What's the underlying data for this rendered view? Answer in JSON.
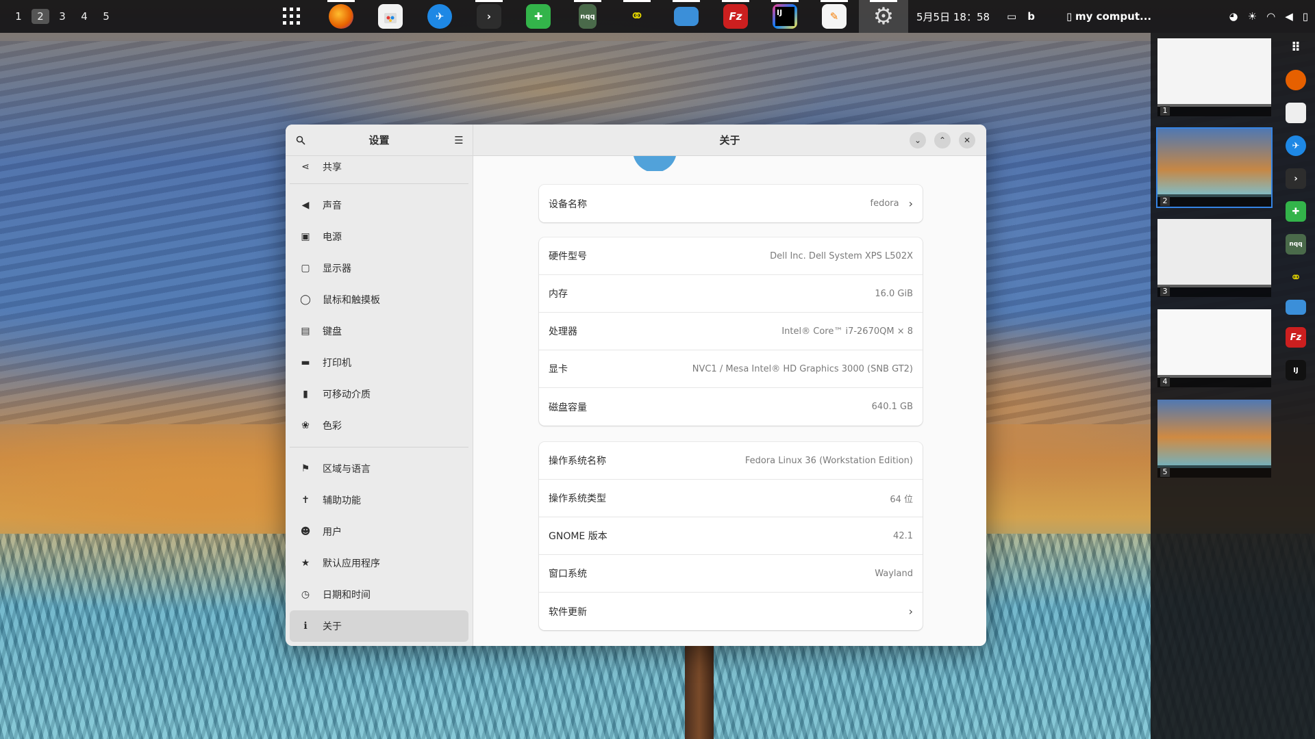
{
  "topbar": {
    "workspaces": [
      "1",
      "2",
      "3",
      "4",
      "5"
    ],
    "active_workspace": "2",
    "clock": "5月5日 18：58",
    "window_title": "my comput...",
    "apps": [
      {
        "name": "app-grid",
        "glyph": "⠿",
        "color": "transparent"
      },
      {
        "name": "firefox",
        "glyph": "ff",
        "color": "#e66000"
      },
      {
        "name": "software-store",
        "glyph": "▦",
        "color": "#e8e8e8"
      },
      {
        "name": "browser",
        "glyph": "✈",
        "color": "#1e88e5"
      },
      {
        "name": "terminal",
        "glyph": ">",
        "color": "#2d2d2d"
      },
      {
        "name": "extensions",
        "glyph": "✚",
        "color": "#33b44a"
      },
      {
        "name": "nqq",
        "glyph": "nqq",
        "color": "#4a6a4a"
      },
      {
        "name": "graph-app",
        "glyph": "⚭",
        "color": "#d4c400"
      },
      {
        "name": "files",
        "glyph": "▭",
        "color": "#3b8fd9"
      },
      {
        "name": "filezilla",
        "glyph": "Fz",
        "color": "#cc1f1f"
      },
      {
        "name": "intellij",
        "glyph": "IJ",
        "color": "#111"
      },
      {
        "name": "text-editor",
        "glyph": "✎",
        "color": "#f0f0f0"
      },
      {
        "name": "settings",
        "glyph": "⚙",
        "color": "#8a8a8a"
      }
    ]
  },
  "sidebar": {
    "title": "设置",
    "items": [
      {
        "label": "共享",
        "icon": "share-icon",
        "glyph": "<"
      },
      {
        "label": "声音",
        "icon": "speaker-icon",
        "glyph": "◀"
      },
      {
        "label": "电源",
        "icon": "power-icon",
        "glyph": "▣"
      },
      {
        "label": "显示器",
        "icon": "display-icon",
        "glyph": "▢"
      },
      {
        "label": "鼠标和触摸板",
        "icon": "mouse-icon",
        "glyph": "◯"
      },
      {
        "label": "键盘",
        "icon": "keyboard-icon",
        "glyph": "▤"
      },
      {
        "label": "打印机",
        "icon": "printer-icon",
        "glyph": "▬"
      },
      {
        "label": "可移动介质",
        "icon": "usb-icon",
        "glyph": "▮"
      },
      {
        "label": "色彩",
        "icon": "color-icon",
        "glyph": "❀"
      },
      {
        "label": "区域与语言",
        "icon": "flag-icon",
        "glyph": "⚑"
      },
      {
        "label": "辅助功能",
        "icon": "accessibility-icon",
        "glyph": "✝"
      },
      {
        "label": "用户",
        "icon": "users-icon",
        "glyph": "☻"
      },
      {
        "label": "默认应用程序",
        "icon": "star-icon",
        "glyph": "★"
      },
      {
        "label": "日期和时间",
        "icon": "clock-icon",
        "glyph": "◷"
      },
      {
        "label": "关于",
        "icon": "info-icon",
        "glyph": "ℹ"
      }
    ]
  },
  "main": {
    "title": "关于",
    "device": {
      "label": "设备名称",
      "value": "fedora"
    },
    "hardware": [
      {
        "label": "硬件型号",
        "value": "Dell Inc. Dell System XPS L502X"
      },
      {
        "label": "内存",
        "value": "16.0 GiB"
      },
      {
        "label": "处理器",
        "value": "Intel® Core™ i7-2670QM × 8"
      },
      {
        "label": "显卡",
        "value": "NVC1 / Mesa Intel® HD Graphics 3000 (SNB GT2)"
      },
      {
        "label": "磁盘容量",
        "value": "640.1 GB"
      }
    ],
    "os": [
      {
        "label": "操作系统名称",
        "value": "Fedora Linux 36 (Workstation Edition)"
      },
      {
        "label": "操作系统类型",
        "value": "64 位"
      },
      {
        "label": "GNOME 版本",
        "value": "42.1"
      },
      {
        "label": "窗口系统",
        "value": "Wayland"
      }
    ],
    "software_update": "软件更新"
  },
  "thumbnails": [
    "1",
    "2",
    "3",
    "4",
    "5"
  ]
}
